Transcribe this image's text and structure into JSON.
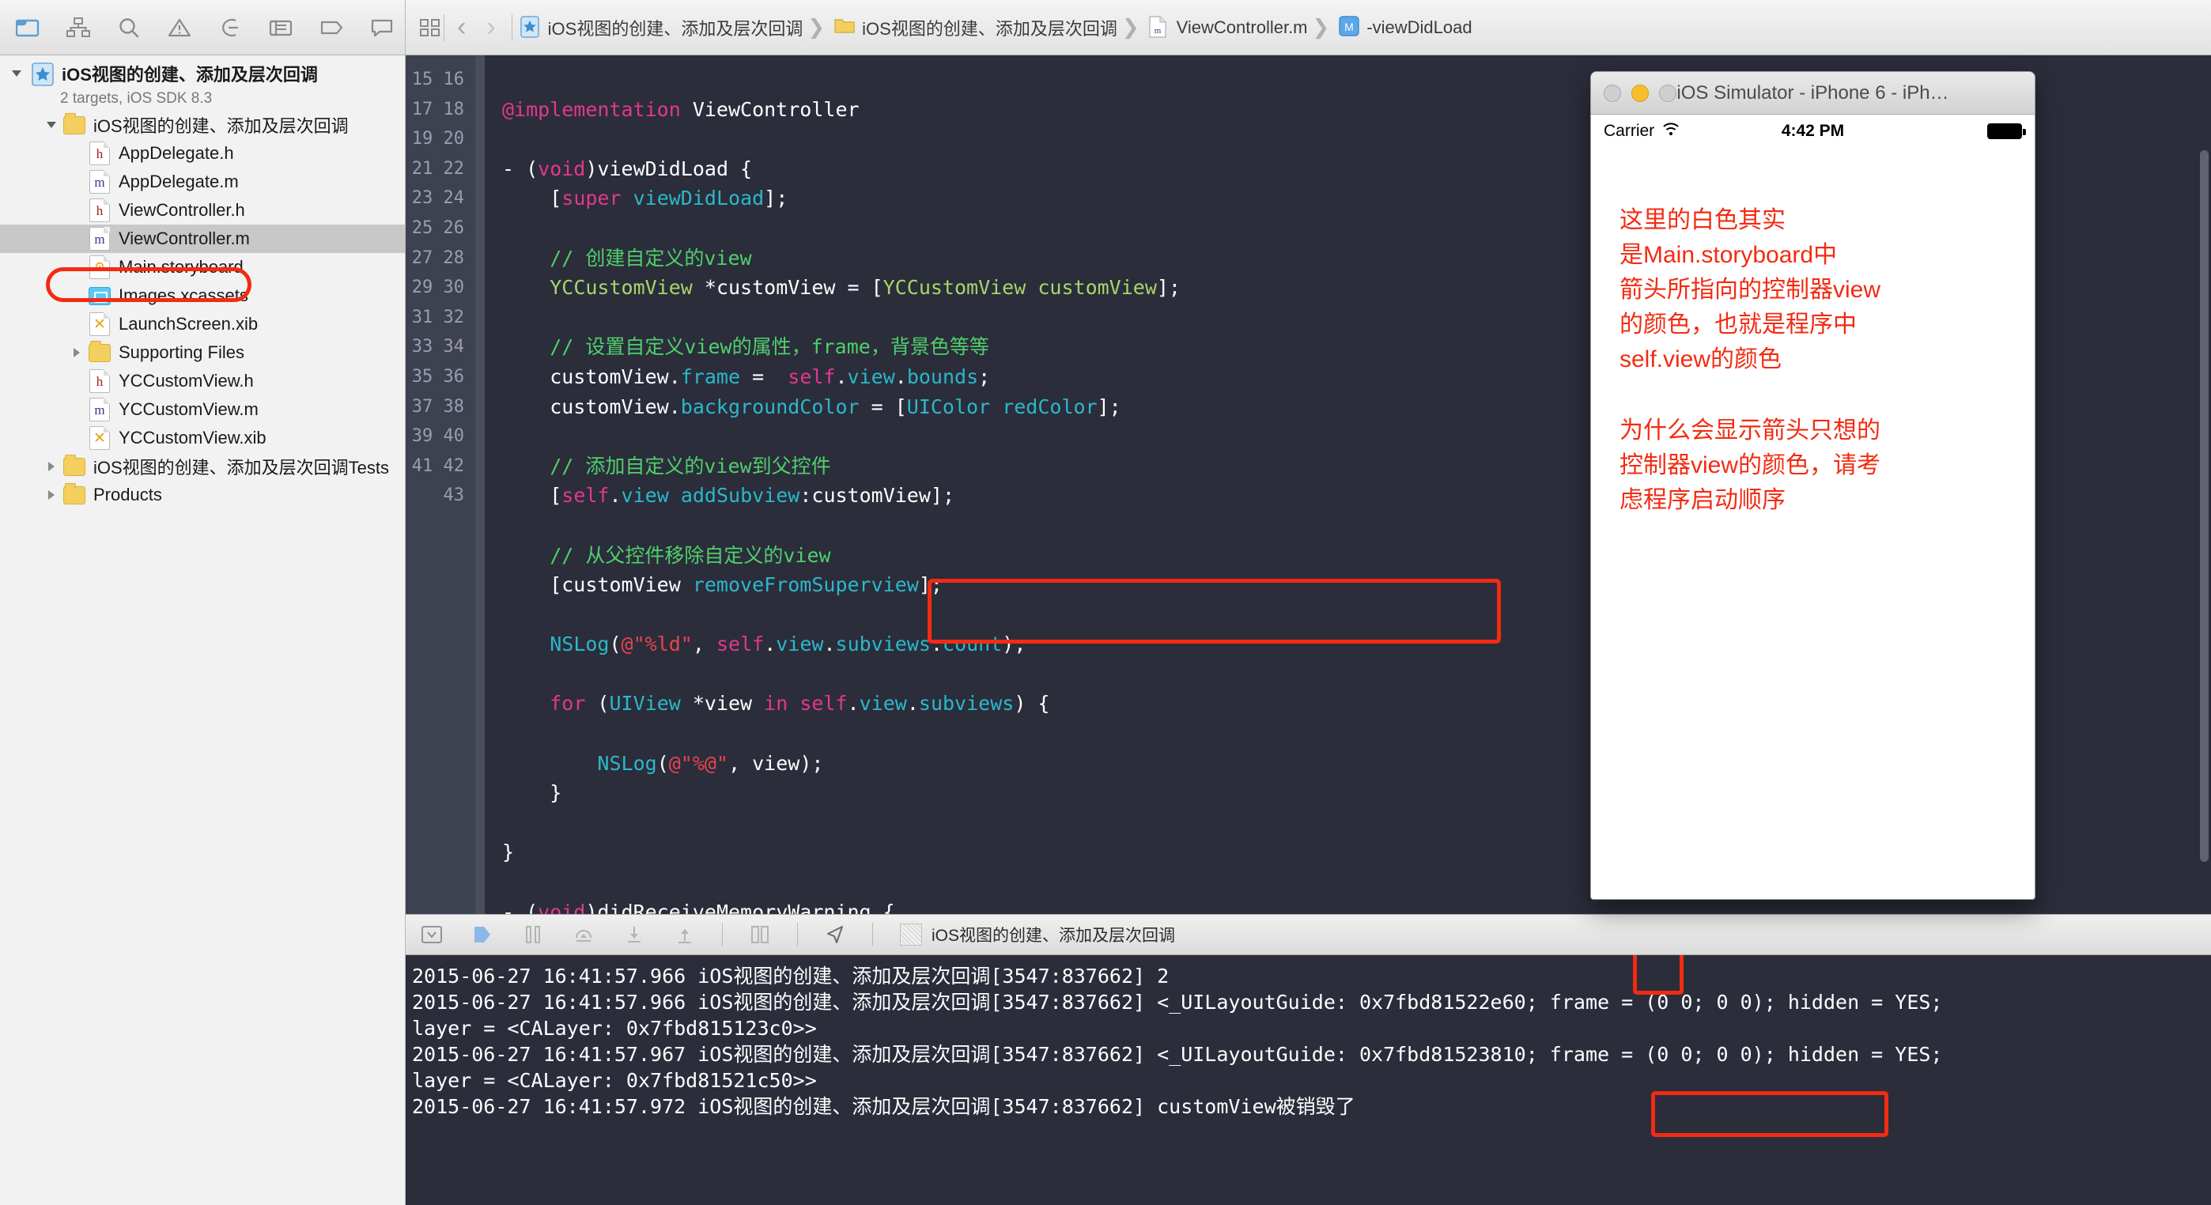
{
  "toolbar": {
    "icons": [
      {
        "name": "folder-navigator-icon",
        "label": "Project navigator"
      },
      {
        "name": "hierarchy-navigator-icon",
        "label": "Symbol navigator"
      },
      {
        "name": "search-navigator-icon",
        "label": "Find navigator"
      },
      {
        "name": "warning-navigator-icon",
        "label": "Issue navigator"
      },
      {
        "name": "test-navigator-icon",
        "label": "Test navigator"
      },
      {
        "name": "debug-navigator-icon",
        "label": "Debug navigator"
      },
      {
        "name": "breakpoint-navigator-icon",
        "label": "Breakpoint navigator"
      },
      {
        "name": "log-navigator-icon",
        "label": "Report navigator"
      }
    ]
  },
  "breadcrumb": {
    "back_label": "‹",
    "forward_label": "›",
    "items": [
      {
        "label": "iOS视图的创建、添加及层次回调",
        "icon": "project-icon"
      },
      {
        "label": "iOS视图的创建、添加及层次回调",
        "icon": "folder-icon"
      },
      {
        "label": "ViewController.m",
        "icon": "m-file-icon"
      },
      {
        "label": "-viewDidLoad",
        "icon": "method-icon"
      }
    ]
  },
  "sidebar": {
    "project": {
      "name": "iOS视图的创建、添加及层次回调",
      "subtitle": "2 targets, iOS SDK 8.3"
    },
    "items": [
      {
        "label": "iOS视图的创建、添加及层次回调",
        "kind": "folder",
        "indent": 1,
        "twisty": "open"
      },
      {
        "label": "AppDelegate.h",
        "kind": "h",
        "indent": 2,
        "twisty": "none"
      },
      {
        "label": "AppDelegate.m",
        "kind": "m",
        "indent": 2,
        "twisty": "none"
      },
      {
        "label": "ViewController.h",
        "kind": "h",
        "indent": 2,
        "twisty": "none"
      },
      {
        "label": "ViewController.m",
        "kind": "m",
        "indent": 2,
        "twisty": "none",
        "selected": true,
        "highlighted": true
      },
      {
        "label": "Main.storyboard",
        "kind": "sb",
        "indent": 2,
        "twisty": "none"
      },
      {
        "label": "Images.xcassets",
        "kind": "xcassets",
        "indent": 2,
        "twisty": "none"
      },
      {
        "label": "LaunchScreen.xib",
        "kind": "xib",
        "indent": 2,
        "twisty": "none"
      },
      {
        "label": "Supporting Files",
        "kind": "folder",
        "indent": 2,
        "twisty": "closed"
      },
      {
        "label": "YCCustomView.h",
        "kind": "h",
        "indent": 2,
        "twisty": "none"
      },
      {
        "label": "YCCustomView.m",
        "kind": "m",
        "indent": 2,
        "twisty": "none"
      },
      {
        "label": "YCCustomView.xib",
        "kind": "xib",
        "indent": 2,
        "twisty": "none"
      },
      {
        "label": "iOS视图的创建、添加及层次回调Tests",
        "kind": "folder",
        "indent": 1,
        "twisty": "closed"
      },
      {
        "label": "Products",
        "kind": "folder",
        "indent": 1,
        "twisty": "closed"
      }
    ]
  },
  "editor": {
    "first_line_number": 15,
    "line_numbers": [
      15,
      16,
      17,
      18,
      19,
      20,
      21,
      22,
      23,
      24,
      25,
      26,
      27,
      28,
      29,
      30,
      31,
      32,
      33,
      34,
      35,
      36,
      37,
      38,
      39,
      40,
      41,
      42,
      43
    ],
    "lines": [
      {
        "n": 15,
        "tokens": []
      },
      {
        "n": 16,
        "tokens": [
          {
            "t": "@implementation ",
            "c": "pp"
          },
          {
            "t": "ViewController",
            "c": "pl"
          }
        ]
      },
      {
        "n": 17,
        "tokens": []
      },
      {
        "n": 18,
        "tokens": [
          {
            "t": "- (",
            "c": "pl"
          },
          {
            "t": "void",
            "c": "kw"
          },
          {
            "t": ")viewDidLoad {",
            "c": "pl"
          }
        ]
      },
      {
        "n": 19,
        "tokens": [
          {
            "t": "    [",
            "c": "pl"
          },
          {
            "t": "super",
            "c": "kw"
          },
          {
            "t": " ",
            "c": "pl"
          },
          {
            "t": "viewDidLoad",
            "c": "ms"
          },
          {
            "t": "];",
            "c": "pl"
          }
        ]
      },
      {
        "n": 20,
        "tokens": []
      },
      {
        "n": 21,
        "tokens": [
          {
            "t": "    // 创建自定义的view",
            "c": "cm"
          }
        ]
      },
      {
        "n": 22,
        "tokens": [
          {
            "t": "    ",
            "c": "pl"
          },
          {
            "t": "YCCustomView",
            "c": "ty"
          },
          {
            "t": " *customView = [",
            "c": "pl"
          },
          {
            "t": "YCCustomView",
            "c": "ty"
          },
          {
            "t": " ",
            "c": "pl"
          },
          {
            "t": "customView",
            "c": "ty"
          },
          {
            "t": "];",
            "c": "pl"
          }
        ]
      },
      {
        "n": 23,
        "tokens": []
      },
      {
        "n": 24,
        "tokens": [
          {
            "t": "    // 设置自定义view的属性，frame，背景色等等",
            "c": "cm"
          }
        ]
      },
      {
        "n": 25,
        "tokens": [
          {
            "t": "    customView.",
            "c": "pl"
          },
          {
            "t": "frame",
            "c": "ms"
          },
          {
            "t": " =  ",
            "c": "pl"
          },
          {
            "t": "self",
            "c": "kw"
          },
          {
            "t": ".",
            "c": "pl"
          },
          {
            "t": "view",
            "c": "ms"
          },
          {
            "t": ".",
            "c": "pl"
          },
          {
            "t": "bounds",
            "c": "ms"
          },
          {
            "t": ";",
            "c": "pl"
          }
        ]
      },
      {
        "n": 26,
        "tokens": [
          {
            "t": "    customView.",
            "c": "pl"
          },
          {
            "t": "backgroundColor",
            "c": "ms"
          },
          {
            "t": " = [",
            "c": "pl"
          },
          {
            "t": "UIColor",
            "c": "ms"
          },
          {
            "t": " ",
            "c": "pl"
          },
          {
            "t": "redColor",
            "c": "ms"
          },
          {
            "t": "];",
            "c": "pl"
          }
        ]
      },
      {
        "n": 27,
        "tokens": []
      },
      {
        "n": 28,
        "tokens": [
          {
            "t": "    // 添加自定义的view到父控件",
            "c": "cm"
          }
        ]
      },
      {
        "n": 29,
        "tokens": [
          {
            "t": "    [",
            "c": "pl"
          },
          {
            "t": "self",
            "c": "kw"
          },
          {
            "t": ".",
            "c": "pl"
          },
          {
            "t": "view",
            "c": "ms"
          },
          {
            "t": " ",
            "c": "pl"
          },
          {
            "t": "addSubview",
            "c": "ms"
          },
          {
            "t": ":customView];",
            "c": "pl"
          }
        ]
      },
      {
        "n": 30,
        "tokens": []
      },
      {
        "n": 31,
        "tokens": [
          {
            "t": "    // 从父控件移除自定义的view",
            "c": "cm"
          }
        ]
      },
      {
        "n": 32,
        "tokens": [
          {
            "t": "    [customView ",
            "c": "pl"
          },
          {
            "t": "removeFromSuperview",
            "c": "ms"
          },
          {
            "t": "];",
            "c": "pl"
          }
        ]
      },
      {
        "n": 33,
        "tokens": []
      },
      {
        "n": 34,
        "tokens": [
          {
            "t": "    ",
            "c": "pl"
          },
          {
            "t": "NSLog",
            "c": "ms"
          },
          {
            "t": "(",
            "c": "pl"
          },
          {
            "t": "@\"%ld\"",
            "c": "st"
          },
          {
            "t": ", ",
            "c": "pl"
          },
          {
            "t": "self",
            "c": "kw"
          },
          {
            "t": ".",
            "c": "pl"
          },
          {
            "t": "view",
            "c": "ms"
          },
          {
            "t": ".",
            "c": "pl"
          },
          {
            "t": "subviews",
            "c": "ms"
          },
          {
            "t": ".",
            "c": "pl"
          },
          {
            "t": "count",
            "c": "ms"
          },
          {
            "t": ");",
            "c": "pl"
          }
        ]
      },
      {
        "n": 35,
        "tokens": []
      },
      {
        "n": 36,
        "tokens": [
          {
            "t": "    ",
            "c": "pl"
          },
          {
            "t": "for",
            "c": "kw"
          },
          {
            "t": " (",
            "c": "pl"
          },
          {
            "t": "UIView",
            "c": "ms"
          },
          {
            "t": " *view ",
            "c": "pl"
          },
          {
            "t": "in",
            "c": "kw"
          },
          {
            "t": " ",
            "c": "pl"
          },
          {
            "t": "self",
            "c": "kw"
          },
          {
            "t": ".",
            "c": "pl"
          },
          {
            "t": "view",
            "c": "ms"
          },
          {
            "t": ".",
            "c": "pl"
          },
          {
            "t": "subviews",
            "c": "ms"
          },
          {
            "t": ") {",
            "c": "pl"
          }
        ]
      },
      {
        "n": 37,
        "tokens": []
      },
      {
        "n": 38,
        "tokens": [
          {
            "t": "        ",
            "c": "pl"
          },
          {
            "t": "NSLog",
            "c": "ms"
          },
          {
            "t": "(",
            "c": "pl"
          },
          {
            "t": "@\"%@\"",
            "c": "st"
          },
          {
            "t": ", view);",
            "c": "pl"
          }
        ]
      },
      {
        "n": 39,
        "tokens": [
          {
            "t": "    }",
            "c": "pl"
          }
        ]
      },
      {
        "n": 40,
        "tokens": []
      },
      {
        "n": 41,
        "tokens": [
          {
            "t": "}",
            "c": "pl"
          }
        ]
      },
      {
        "n": 42,
        "tokens": []
      },
      {
        "n": 43,
        "tokens": [
          {
            "t": "- (",
            "c": "pl"
          },
          {
            "t": "void",
            "c": "kw"
          },
          {
            "t": ")didReceiveMemoryWarning {",
            "c": "pl"
          }
        ]
      }
    ]
  },
  "simulator": {
    "title": "iOS Simulator - iPhone 6 - iPh…",
    "carrier": "Carrier",
    "time": "4:42 PM",
    "annotations": [
      "这里的白色其实\n是Main.storyboard中\n箭头所指向的控制器view\n的颜色，也就是程序中\nself.view的颜色",
      "为什么会显示箭头只想的\n控制器view的颜色，请考\n虑程序启动顺序"
    ]
  },
  "debugbar": {
    "icons": [
      {
        "name": "hide-debug-area-icon"
      },
      {
        "name": "continue-program-icon"
      },
      {
        "name": "pause-icon"
      },
      {
        "name": "step-over-icon"
      },
      {
        "name": "step-into-icon"
      },
      {
        "name": "step-out-icon"
      },
      {
        "name": "view-hierarchy-icon"
      },
      {
        "name": "location-simulate-icon"
      }
    ],
    "process_label": "iOS视图的创建、添加及层次回调"
  },
  "console": {
    "lines": [
      "2015-06-27 16:41:57.966 iOS视图的创建、添加及层次回调[3547:837662] 2",
      "2015-06-27 16:41:57.966 iOS视图的创建、添加及层次回调[3547:837662] <_UILayoutGuide: 0x7fbd81522e60; frame = (0 0; 0 0); hidden = YES;",
      "layer = <CALayer: 0x7fbd815123c0>>",
      "2015-06-27 16:41:57.967 iOS视图的创建、添加及层次回调[3547:837662] <_UILayoutGuide: 0x7fbd81523810; frame = (0 0; 0 0); hidden = YES;",
      "layer = <CALayer: 0x7fbd81521c50>>",
      "2015-06-27 16:41:57.972 iOS视图的创建、添加及层次回调[3547:837662] customView被销毁了"
    ],
    "highlight_count": "2",
    "highlight_destroyed": "customView被销毁了"
  },
  "colors": {
    "accent_red": "#f32b12",
    "editor_bg": "#2b2d3b",
    "gutter_bg": "#3e414f",
    "comment_green": "#4fd06a",
    "keyword_pink": "#e2388d",
    "method_cyan": "#2bb8c9",
    "type_green": "#a8d66a",
    "string_red": "#e8434d"
  }
}
